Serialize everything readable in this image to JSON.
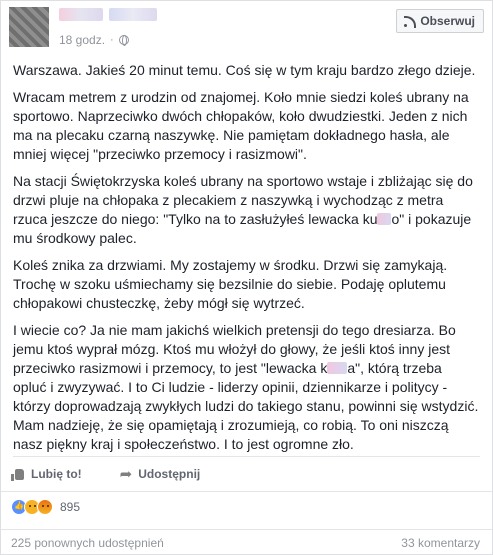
{
  "header": {
    "time": "18 godz.",
    "dot": "·",
    "follow_label": "Obserwuj"
  },
  "post": {
    "paragraphs": [
      "Warszawa. Jakieś 20 minut temu. Coś się w tym kraju bardzo złego dzieje.",
      "Wracam metrem z urodzin od znajomej. Koło mnie siedzi koleś ubrany na sportowo. Naprzeciwko dwóch chłopaków, koło dwudziestki. Jeden z nich ma na plecaku czarną naszywkę. Nie pamiętam dokładnego hasła, ale mniej więcej \"przeciwko przemocy i rasizmowi\"."
    ],
    "p3_before": "Na stacji Świętokrzyska koleś ubrany na sportowo wstaje i zbliżając się do drzwi pluje na chłopaka z plecakiem z naszywką i wychodząc z metra rzuca jeszcze do niego: \"Tylko na to zasłużyłeś lewacka ku",
    "p3_after": "o\" i pokazuje mu środkowy palec.",
    "p4": "Koleś znika za drzwiami. My zostajemy w środku. Drzwi się zamykają. Trochę w szoku uśmiechamy się bezsilnie do siebie. Podaję oplutemu chłopakowi chusteczkę, żeby mógł się wytrzeć.",
    "p5_before": "I wiecie co? Ja nie mam jakichś wielkich pretensji do tego dresiarza. Bo jemu ktoś wyprał mózg. Ktoś mu włożył do głowy, że jeśli ktoś inny jest przeciwko rasizmowi i przemocy, to jest \"lewacka k",
    "p5_after": "a\", którą trzeba opluć i zwyzywać. I to Ci ludzie - liderzy opinii, dziennikarze i politycy - którzy doprowadzają zwykłych ludzi do takiego stanu, powinni się wstydzić. Mam nadzieję, że się opamiętają i zrozumieją, co robią. To oni niszczą nasz piękny kraj i społeczeństwo. I to jest ogromne zło."
  },
  "actions": {
    "like_label": "Lubię to!",
    "share_label": "Udostępnij"
  },
  "reactions": {
    "count": "895",
    "types": [
      "like-icon",
      "sad-icon",
      "angry-icon"
    ]
  },
  "footer": {
    "shares": "225 ponownych udostępnień",
    "comments": "33 komentarzy"
  }
}
